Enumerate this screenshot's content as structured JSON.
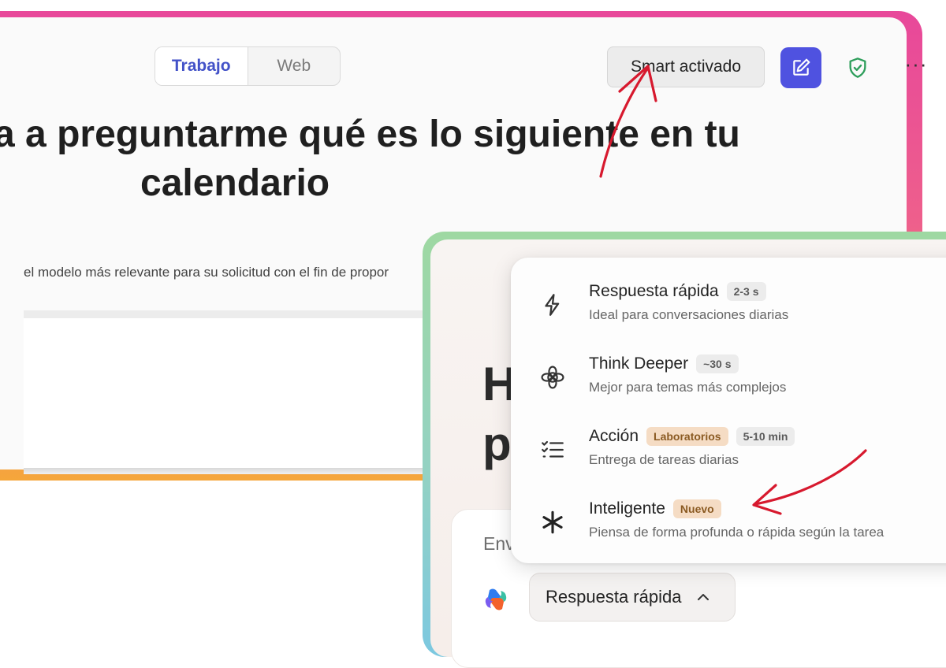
{
  "back_window": {
    "tabs": [
      {
        "label": "Trabajo",
        "active": true
      },
      {
        "label": "Web",
        "active": false
      }
    ],
    "smart_button_label": "Smart activado",
    "headline_line1": "a a preguntarme qué es lo siguiente en tu",
    "headline_line2": "calendario",
    "description": "el modelo más relevante para su solicitud con el fin de propor"
  },
  "front_window": {
    "heading_partial": "H\np",
    "composer_placeholder": "Env",
    "response_selector_label": "Respuesta rápida"
  },
  "mode_menu": {
    "items": [
      {
        "title": "Respuesta rápida",
        "badges": [
          "2-3 s"
        ],
        "subtitle": "Ideal para conversaciones diarias",
        "icon": "lightning-icon"
      },
      {
        "title": "Think Deeper",
        "badges": [
          "~30 s"
        ],
        "subtitle": "Mejor para temas más complejos",
        "icon": "flower-icon"
      },
      {
        "title": "Acción",
        "badges": [
          "Laboratorios",
          "5-10 min"
        ],
        "subtitle": "Entrega de tareas diarias",
        "icon": "checklist-icon"
      },
      {
        "title": "Inteligente",
        "badges": [
          "Nuevo"
        ],
        "subtitle": "Piensa de forma profunda o rápida según la tarea",
        "icon": "sparkle-asterisk-icon"
      }
    ]
  },
  "colors": {
    "accent_blue": "#4f52e0",
    "active_tab_text": "#4352c8",
    "annotation_red": "#d7192e",
    "shield_green": "#2e9e5b",
    "badge_tan_bg": "#f5dcc4"
  }
}
